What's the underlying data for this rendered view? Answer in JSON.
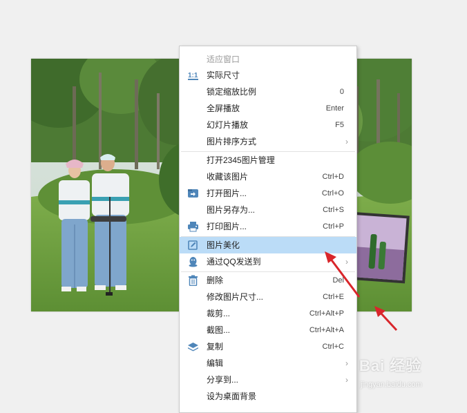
{
  "menu": {
    "items": [
      {
        "label": "适应窗口",
        "shortcut": "",
        "icon": "",
        "submenu": false,
        "disabled": true
      },
      {
        "label": "实际尺寸",
        "shortcut": "",
        "icon": "1:1",
        "submenu": false
      },
      {
        "label": "锁定缩放比例",
        "shortcut": "0",
        "icon": "",
        "submenu": false
      },
      {
        "label": "全屏播放",
        "shortcut": "Enter",
        "icon": "",
        "submenu": false
      },
      {
        "label": "幻灯片播放",
        "shortcut": "F5",
        "icon": "",
        "submenu": false
      },
      {
        "label": "图片排序方式",
        "shortcut": "",
        "icon": "",
        "submenu": true
      },
      {
        "label": "打开2345图片管理",
        "shortcut": "",
        "icon": "",
        "submenu": false
      },
      {
        "label": "收藏该图片",
        "shortcut": "Ctrl+D",
        "icon": "",
        "submenu": false
      },
      {
        "label": "打开图片...",
        "shortcut": "Ctrl+O",
        "icon": "open-folder-icon",
        "submenu": false
      },
      {
        "label": "图片另存为...",
        "shortcut": "Ctrl+S",
        "icon": "",
        "submenu": false
      },
      {
        "label": "打印图片...",
        "shortcut": "Ctrl+P",
        "icon": "printer-icon",
        "submenu": false
      },
      {
        "label": "图片美化",
        "shortcut": "",
        "icon": "edit-image-icon",
        "submenu": false,
        "highlighted": true
      },
      {
        "label": "通过QQ发送到",
        "shortcut": "",
        "icon": "qq-penguin-icon",
        "submenu": true
      },
      {
        "label": "删除",
        "shortcut": "Del",
        "icon": "trash-icon",
        "submenu": false
      },
      {
        "label": "修改图片尺寸...",
        "shortcut": "Ctrl+E",
        "icon": "",
        "submenu": false
      },
      {
        "label": "裁剪...",
        "shortcut": "Ctrl+Alt+P",
        "icon": "",
        "submenu": false
      },
      {
        "label": "截图...",
        "shortcut": "Ctrl+Alt+A",
        "icon": "",
        "submenu": false
      },
      {
        "label": "复制",
        "shortcut": "Ctrl+C",
        "icon": "copy-layers-icon",
        "submenu": false
      },
      {
        "label": "编辑",
        "shortcut": "",
        "icon": "",
        "submenu": true
      },
      {
        "label": "分享到...",
        "shortcut": "",
        "icon": "",
        "submenu": true
      },
      {
        "label": "设为桌面背景",
        "shortcut": "",
        "icon": "",
        "submenu": false
      }
    ]
  },
  "watermark": {
    "main": "Bai 经验",
    "sub": "jingyan.baidu.com"
  },
  "colors": {
    "highlight": "#bbdcf7",
    "icon_blue": "#4f86b9",
    "arrow_red": "#d9262b"
  }
}
